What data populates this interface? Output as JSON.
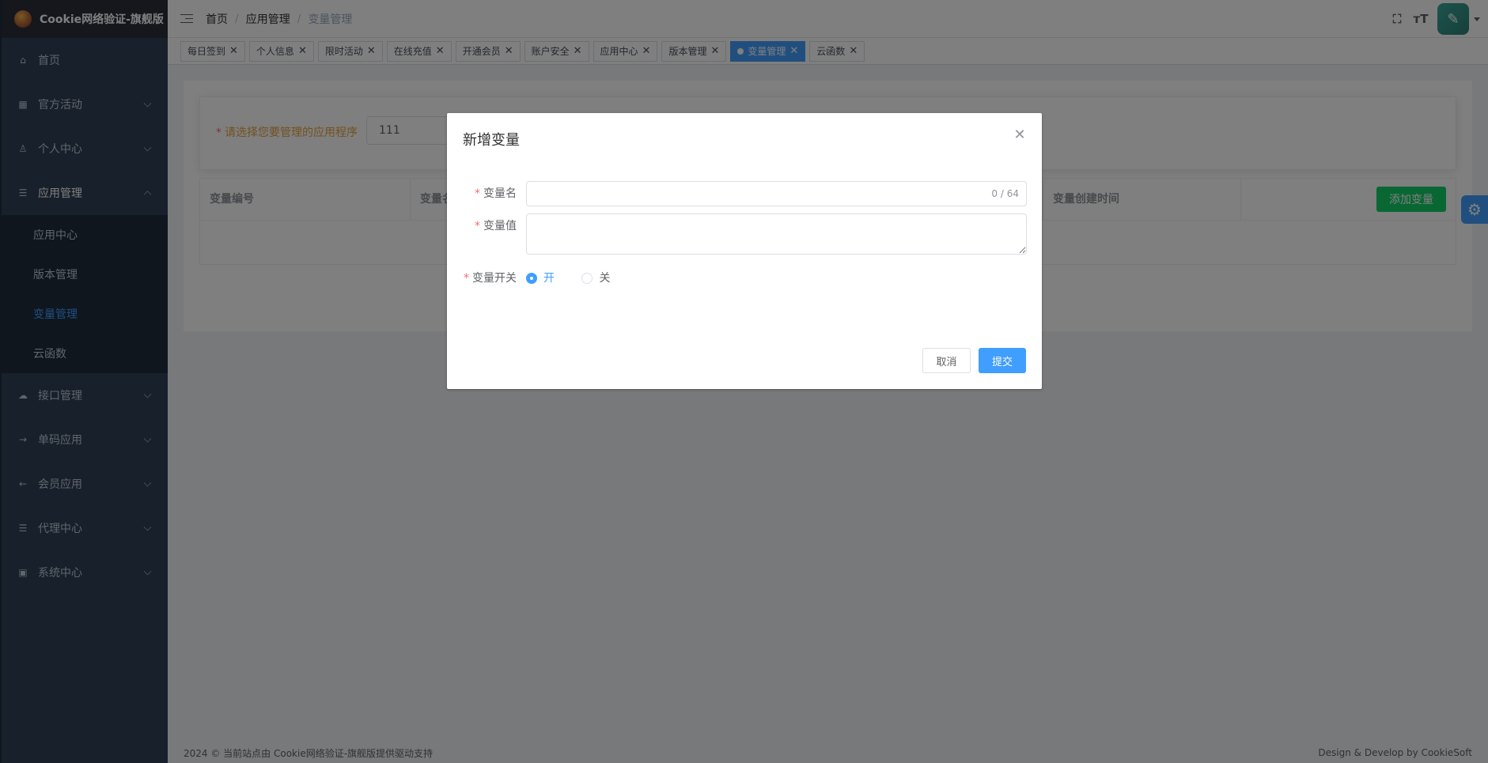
{
  "app": {
    "title": "Cookie网络验证-旗舰版"
  },
  "sidebar": {
    "items": [
      {
        "label": "首页",
        "icon": "home-icon"
      },
      {
        "label": "官方活动",
        "icon": "grid-icon"
      },
      {
        "label": "个人中心",
        "icon": "user-icon"
      },
      {
        "label": "应用管理",
        "icon": "tree-icon"
      },
      {
        "label": "接口管理",
        "icon": "cloud-icon"
      },
      {
        "label": "单码应用",
        "icon": "login-icon"
      },
      {
        "label": "会员应用",
        "icon": "logout-icon"
      },
      {
        "label": "代理中心",
        "icon": "tree-icon"
      },
      {
        "label": "系统中心",
        "icon": "monitor-icon"
      }
    ],
    "submenu": [
      "应用中心",
      "版本管理",
      "变量管理",
      "云函数"
    ]
  },
  "breadcrumb": [
    "首页",
    "应用管理",
    "变量管理"
  ],
  "tags": [
    "每日签到",
    "个人信息",
    "限时活动",
    "在线充值",
    "开通会员",
    "账户安全",
    "应用中心",
    "版本管理",
    "变量管理",
    "云函数"
  ],
  "filter": {
    "label": "请选择您要管理的应用程序",
    "value": "111"
  },
  "table": {
    "columns": [
      "变量编号",
      "变量名",
      "变量创建时间"
    ],
    "add_button": "添加变量"
  },
  "footer": {
    "left": "2024 © 当前站点由 Cookie网络验证-旗舰版提供驱动支持",
    "right": "Design & Develop by CookieSoft"
  },
  "dialog": {
    "title": "新增变量",
    "name_label": "变量名",
    "name_counter": "0 / 64",
    "value_label": "变量值",
    "switch_label": "变量开关",
    "switch_on": "开",
    "switch_off": "关",
    "cancel": "取消",
    "submit": "提交"
  },
  "colors": {
    "sidebar_bg": "#304156",
    "primary": "#409eff",
    "success": "#13ce66",
    "required": "#f56c6c"
  }
}
